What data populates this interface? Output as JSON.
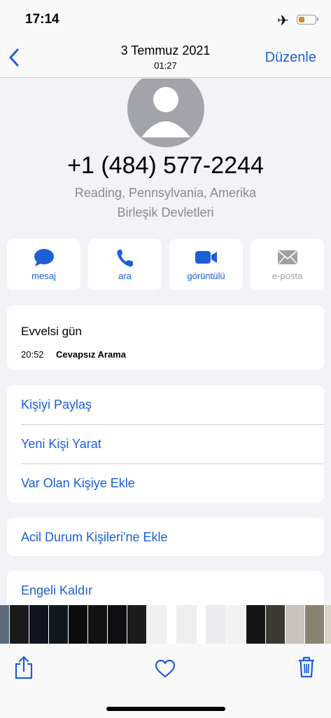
{
  "status": {
    "time": "17:14",
    "battery_level": 0.4,
    "airplane_mode": true
  },
  "nav": {
    "date": "3 Temmuz 2021",
    "time": "01:27",
    "edit_label": "Düzenle",
    "back_icon": "chevron-left-icon"
  },
  "contact": {
    "phone": "+1 (484) 577-2244",
    "location_line1": "Reading, Pennsylvania, Amerika",
    "location_line2": "Birleşik Devletleri"
  },
  "actions": [
    {
      "label": "mesaj",
      "icon": "message-icon",
      "enabled": true
    },
    {
      "label": "ara",
      "icon": "phone-icon",
      "enabled": true
    },
    {
      "label": "görüntülü",
      "icon": "video-icon",
      "enabled": true
    },
    {
      "label": "e-posta",
      "icon": "mail-icon",
      "enabled": false
    }
  ],
  "recents": {
    "title": "Evvelsi gün",
    "time": "20:52",
    "type": "Cevapsız Arama"
  },
  "options": [
    {
      "label": "Kişiyi Paylaş"
    },
    {
      "label": "Yeni Kişi Yarat"
    },
    {
      "label": "Var Olan Kişiye Ekle"
    }
  ],
  "emergency_label": "Acil Durum Kişileri'ne Ekle",
  "unblock_label": "Engeli Kaldır",
  "toolbar": {
    "share_icon": "share-icon",
    "favorite_icon": "heart-icon",
    "delete_icon": "trash-icon"
  },
  "colors": {
    "accent": "#1c5fd6",
    "background": "#f2f2f7",
    "card": "#ffffff",
    "secondary_text": "#8a8a8e"
  }
}
